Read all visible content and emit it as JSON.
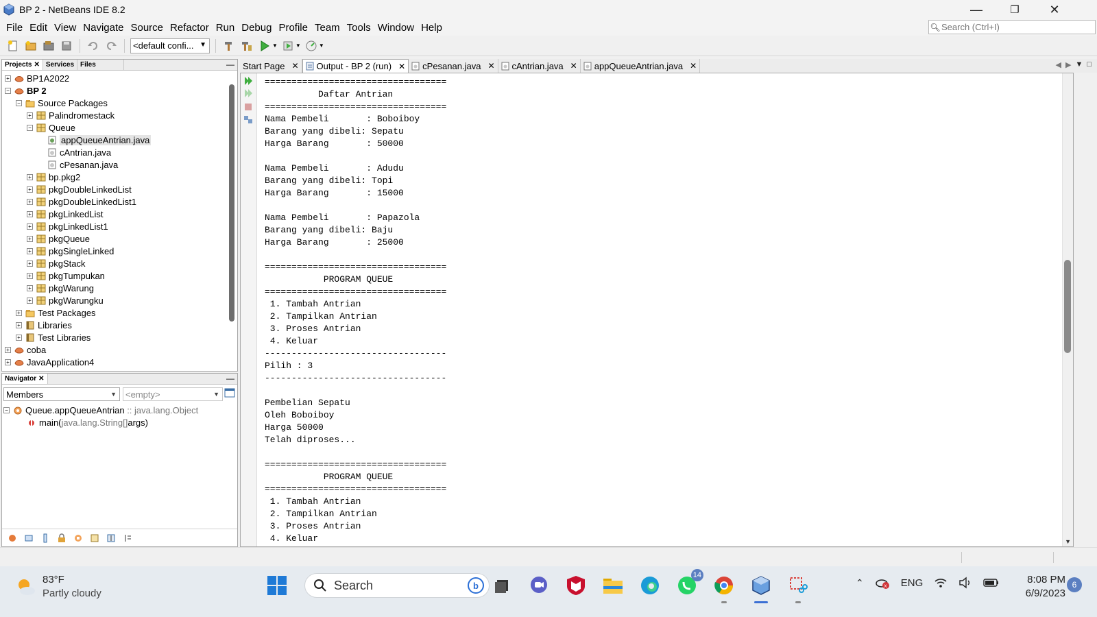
{
  "window": {
    "title": "BP 2 - NetBeans IDE 8.2",
    "minimize": "—",
    "maximize": "❐",
    "close": "✕"
  },
  "menu": [
    "File",
    "Edit",
    "View",
    "Navigate",
    "Source",
    "Refactor",
    "Run",
    "Debug",
    "Profile",
    "Team",
    "Tools",
    "Window",
    "Help"
  ],
  "search": {
    "placeholder": "Search (Ctrl+I)"
  },
  "toolbar": {
    "config": "<default confi..."
  },
  "projects_panel": {
    "tabs": [
      "Projects",
      "Services",
      "Files"
    ],
    "tree": [
      {
        "label": "BP1A2022",
        "level": 0,
        "type": "project",
        "exp": "+"
      },
      {
        "label": "BP 2",
        "level": 0,
        "type": "project",
        "exp": "-",
        "bold": true
      },
      {
        "label": "Source Packages",
        "level": 1,
        "type": "folder",
        "exp": "-"
      },
      {
        "label": "Palindromestack",
        "level": 2,
        "type": "package",
        "exp": "+"
      },
      {
        "label": "Queue",
        "level": 2,
        "type": "package",
        "exp": "-"
      },
      {
        "label": "appQueueAntrian.java",
        "level": 3,
        "type": "java-main",
        "exp": "",
        "selected": true
      },
      {
        "label": "cAntrian.java",
        "level": 3,
        "type": "java",
        "exp": ""
      },
      {
        "label": "cPesanan.java",
        "level": 3,
        "type": "java",
        "exp": ""
      },
      {
        "label": "bp.pkg2",
        "level": 2,
        "type": "package",
        "exp": "+"
      },
      {
        "label": "pkgDoubleLinkedList",
        "level": 2,
        "type": "package",
        "exp": "+"
      },
      {
        "label": "pkgDoubleLinkedList1",
        "level": 2,
        "type": "package",
        "exp": "+"
      },
      {
        "label": "pkgLinkedList",
        "level": 2,
        "type": "package",
        "exp": "+"
      },
      {
        "label": "pkgLinkedList1",
        "level": 2,
        "type": "package",
        "exp": "+"
      },
      {
        "label": "pkgQueue",
        "level": 2,
        "type": "package",
        "exp": "+"
      },
      {
        "label": "pkgSingleLinked",
        "level": 2,
        "type": "package",
        "exp": "+"
      },
      {
        "label": "pkgStack",
        "level": 2,
        "type": "package",
        "exp": "+"
      },
      {
        "label": "pkgTumpukan",
        "level": 2,
        "type": "package",
        "exp": "+"
      },
      {
        "label": "pkgWarung",
        "level": 2,
        "type": "package",
        "exp": "+"
      },
      {
        "label": "pkgWarungku",
        "level": 2,
        "type": "package",
        "exp": "+"
      },
      {
        "label": "Test Packages",
        "level": 1,
        "type": "folder",
        "exp": "+"
      },
      {
        "label": "Libraries",
        "level": 1,
        "type": "library",
        "exp": "+"
      },
      {
        "label": "Test Libraries",
        "level": 1,
        "type": "library",
        "exp": "+"
      },
      {
        "label": "coba",
        "level": 0,
        "type": "project",
        "exp": "+"
      },
      {
        "label": "JavaApplication4",
        "level": 0,
        "type": "project",
        "exp": "+"
      }
    ]
  },
  "navigator": {
    "tab": "Navigator",
    "members": "Members",
    "filter": "<empty>",
    "class_name": "Queue.appQueueAntrian",
    "class_super": ":: java.lang.Object",
    "method_name": "main(",
    "method_params": "java.lang.String[]",
    "method_rest": " args)"
  },
  "editor_tabs": [
    {
      "label": "Start Page",
      "icon": "",
      "active": false
    },
    {
      "label": "Output - BP 2 (run)",
      "icon": "output",
      "active": true
    },
    {
      "label": "cPesanan.java",
      "icon": "java",
      "active": false
    },
    {
      "label": "cAntrian.java",
      "icon": "java",
      "active": false
    },
    {
      "label": "appQueueAntrian.java",
      "icon": "java",
      "active": false
    }
  ],
  "output": {
    "lines": [
      "==================================",
      "          Daftar Antrian",
      "==================================",
      "Nama Pembeli       : Boboiboy",
      "Barang yang dibeli: Sepatu",
      "Harga Barang       : 50000",
      "",
      "Nama Pembeli       : Adudu",
      "Barang yang dibeli: Topi",
      "Harga Barang       : 15000",
      "",
      "Nama Pembeli       : Papazola",
      "Barang yang dibeli: Baju",
      "Harga Barang       : 25000",
      "",
      "==================================",
      "           PROGRAM QUEUE",
      "==================================",
      " 1. Tambah Antrian",
      " 2. Tampilkan Antrian",
      " 3. Proses Antrian",
      " 4. Keluar",
      "----------------------------------",
      "Pilih : 3",
      "----------------------------------",
      "",
      "Pembelian Sepatu",
      "Oleh Boboiboy",
      "Harga 50000",
      "Telah diproses...",
      "",
      "==================================",
      "           PROGRAM QUEUE",
      "==================================",
      " 1. Tambah Antrian",
      " 2. Tampilkan Antrian",
      " 3. Proses Antrian",
      " 4. Keluar"
    ]
  },
  "taskbar": {
    "weather_temp": "83°F",
    "weather_desc": "Partly cloudy",
    "search_label": "Search",
    "whatsapp_badge": "14",
    "lang": "ENG",
    "time": "8:08 PM",
    "date": "6/9/2023",
    "notifications": "6"
  }
}
